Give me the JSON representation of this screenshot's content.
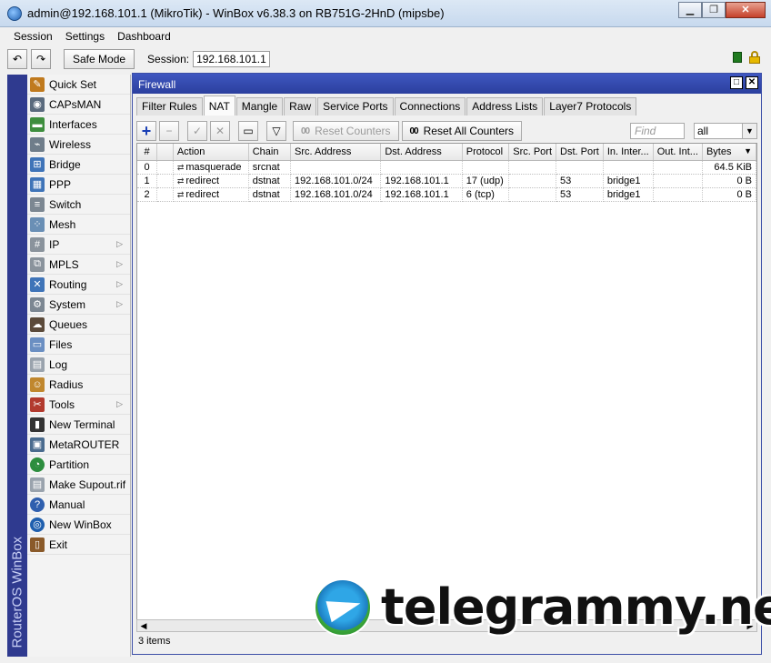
{
  "window": {
    "title": "admin@192.168.101.1 (MikroTik) - WinBox v6.38.3 on RB751G-2HnD (mipsbe)",
    "buttons": {
      "minimize": "▁",
      "maximize": "❐",
      "close": "✕"
    }
  },
  "menu": [
    "Session",
    "Settings",
    "Dashboard"
  ],
  "toolbar": {
    "undo_icon": "↶",
    "redo_icon": "↷",
    "safe_mode_label": "Safe Mode",
    "session_label": "Session:",
    "session_value": "192.168.101.1"
  },
  "brand": "RouterOS WinBox",
  "sidebar": {
    "items": [
      {
        "label": "Quick Set",
        "icon": "quickset-icon",
        "arrow": ""
      },
      {
        "label": "CAPsMAN",
        "icon": "capsman-icon",
        "arrow": ""
      },
      {
        "label": "Interfaces",
        "icon": "interfaces-icon",
        "arrow": ""
      },
      {
        "label": "Wireless",
        "icon": "wireless-icon",
        "arrow": ""
      },
      {
        "label": "Bridge",
        "icon": "bridge-icon",
        "arrow": ""
      },
      {
        "label": "PPP",
        "icon": "ppp-icon",
        "arrow": ""
      },
      {
        "label": "Switch",
        "icon": "switch-icon",
        "arrow": ""
      },
      {
        "label": "Mesh",
        "icon": "mesh-icon",
        "arrow": ""
      },
      {
        "label": "IP",
        "icon": "ip-icon",
        "arrow": "▷"
      },
      {
        "label": "MPLS",
        "icon": "mpls-icon",
        "arrow": "▷"
      },
      {
        "label": "Routing",
        "icon": "routing-icon",
        "arrow": "▷"
      },
      {
        "label": "System",
        "icon": "system-icon",
        "arrow": "▷"
      },
      {
        "label": "Queues",
        "icon": "queues-icon",
        "arrow": ""
      },
      {
        "label": "Files",
        "icon": "files-icon",
        "arrow": ""
      },
      {
        "label": "Log",
        "icon": "log-icon",
        "arrow": ""
      },
      {
        "label": "Radius",
        "icon": "radius-icon",
        "arrow": ""
      },
      {
        "label": "Tools",
        "icon": "tools-icon",
        "arrow": "▷"
      },
      {
        "label": "New Terminal",
        "icon": "terminal-icon",
        "arrow": ""
      },
      {
        "label": "MetaROUTER",
        "icon": "metarouter-icon",
        "arrow": ""
      },
      {
        "label": "Partition",
        "icon": "partition-icon",
        "arrow": ""
      },
      {
        "label": "Make Supout.rif",
        "icon": "supout-icon",
        "arrow": ""
      },
      {
        "label": "Manual",
        "icon": "manual-icon",
        "arrow": ""
      },
      {
        "label": "New WinBox",
        "icon": "winbox-icon",
        "arrow": ""
      },
      {
        "label": "Exit",
        "icon": "exit-icon",
        "arrow": ""
      }
    ]
  },
  "firewall": {
    "title": "Firewall",
    "title_buttons": {
      "restore": "□",
      "close": "✕"
    },
    "tabs": [
      "Filter Rules",
      "NAT",
      "Mangle",
      "Raw",
      "Service Ports",
      "Connections",
      "Address Lists",
      "Layer7 Protocols"
    ],
    "active_tab": "NAT",
    "actions": {
      "add": "+",
      "remove": "−",
      "enable": "✓",
      "disable": "✕",
      "comment": "▭",
      "filter": "▽",
      "reset_counters_label": "Reset Counters",
      "reset_all_counters_label": "Reset All Counters",
      "counter_glyph": "00"
    },
    "find_placeholder": "Find",
    "filter_value": "all",
    "columns": [
      "#",
      "",
      "Action",
      "Chain",
      "Src. Address",
      "Dst. Address",
      "Protocol",
      "Src. Port",
      "Dst. Port",
      "In. Inter...",
      "Out. Int...",
      "Bytes"
    ],
    "rows": [
      {
        "num": "0",
        "flag": "",
        "action": "masquerade",
        "chain": "srcnat",
        "src": "",
        "dst": "",
        "protocol": "",
        "sport": "",
        "dport": "",
        "in_if": "",
        "out_if": "",
        "bytes": "64.5 KiB"
      },
      {
        "num": "1",
        "flag": "",
        "action": "redirect",
        "chain": "dstnat",
        "src": "192.168.101.0/24",
        "dst": "192.168.101.1",
        "protocol": "17 (udp)",
        "sport": "",
        "dport": "53",
        "in_if": "bridge1",
        "out_if": "",
        "bytes": "0 B"
      },
      {
        "num": "2",
        "flag": "",
        "action": "redirect",
        "chain": "dstnat",
        "src": "192.168.101.0/24",
        "dst": "192.168.101.1",
        "protocol": "6 (tcp)",
        "sport": "",
        "dport": "53",
        "in_if": "bridge1",
        "out_if": "",
        "bytes": "0 B"
      }
    ],
    "status": "3 items"
  },
  "watermark": "telegrammy.net"
}
